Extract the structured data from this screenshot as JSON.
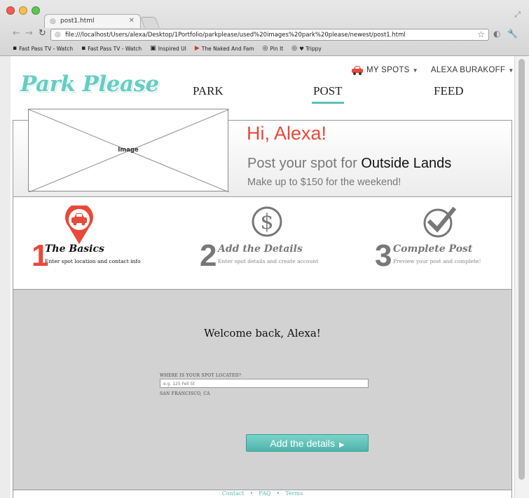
{
  "browser": {
    "tab_title": "post1.html",
    "url": "file:///localhost/Users/alexa/Desktop/1Portfolio/parkplease/used%20images%20park%20please/newest/post1.html",
    "bookmarks": [
      {
        "label": "Fast Pass TV - Watch",
        "icon": "tv-icon"
      },
      {
        "label": "Fast Pass TV - Watch",
        "icon": "tv-icon"
      },
      {
        "label": "Inspired UI",
        "icon": "ui-icon"
      },
      {
        "label": "The Naked And Fam",
        "icon": "youtube-icon"
      },
      {
        "label": "Pin It",
        "icon": "globe-icon"
      },
      {
        "label": "♥ Trippy",
        "icon": "globe-icon"
      }
    ]
  },
  "site": {
    "logo": "Park Please",
    "user_nav": {
      "my_spots": "MY SPOTS",
      "user_name": "ALEXA BURAKOFF"
    },
    "main_nav": [
      "PARK",
      "POST",
      "FEED"
    ],
    "active_nav": "POST",
    "accent_color": "#5cc1b9",
    "highlight_color": "#e8493a"
  },
  "hero": {
    "image_label": "Image",
    "greeting": "Hi, Alexa!",
    "post_prefix": "Post your spot for",
    "event_name": "Outside Lands",
    "earn_text": "Make up to $150 for the weekend!"
  },
  "steps": [
    {
      "number": "1",
      "title": "The Basics",
      "subtitle": "Enter spot location and contact info",
      "icon": "car-location-pin-icon",
      "active": true
    },
    {
      "number": "2",
      "title": "Add the Details",
      "subtitle": "Enter spot details and create account",
      "icon": "dollar-circle-icon",
      "active": false
    },
    {
      "number": "3",
      "title": "Complete Post",
      "subtitle": "Preview your post and complete!",
      "icon": "check-circle-icon",
      "active": false
    }
  ],
  "form": {
    "welcome": "Welcome back, Alexa!",
    "location_label": "WHERE IS YOUR SPOT LOCATED?",
    "location_placeholder": "e.g. 125 Fell St",
    "location_value": "",
    "city": "SAN FRANCISCO, CA",
    "submit_label": "Add the details"
  },
  "footer": {
    "links": [
      "Contact",
      "FAQ",
      "Terms"
    ]
  }
}
